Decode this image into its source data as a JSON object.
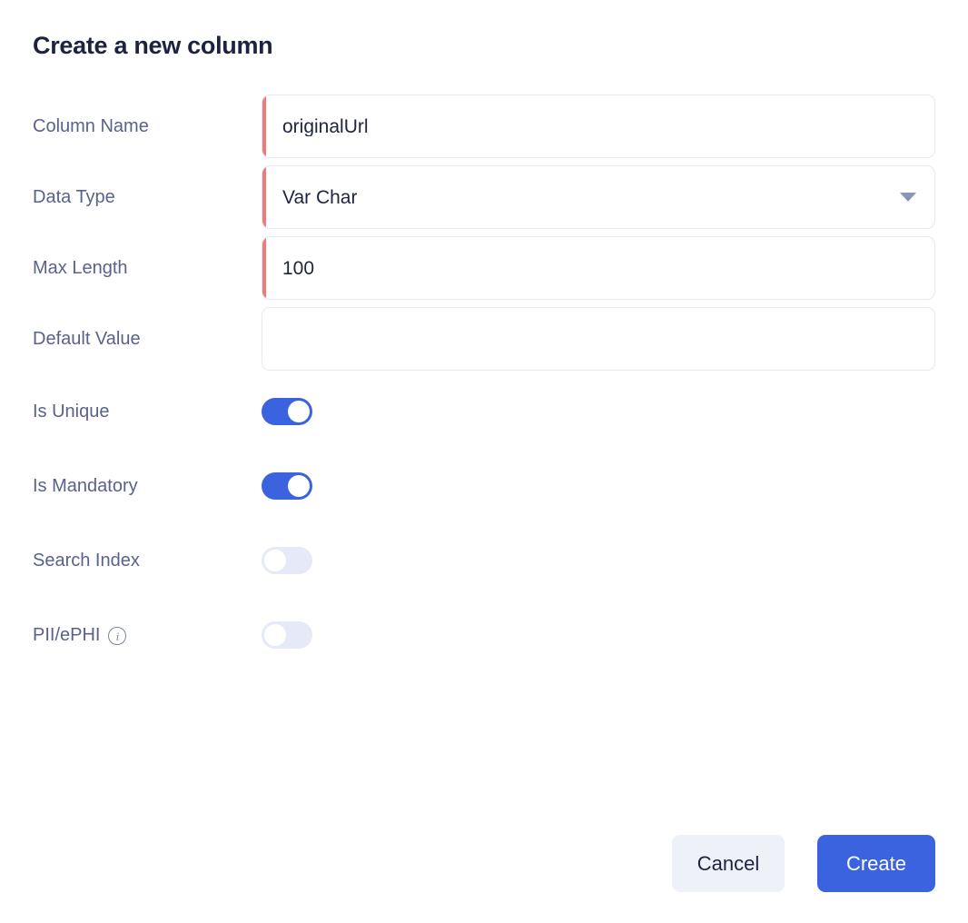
{
  "dialog": {
    "title": "Create a new column"
  },
  "fields": [
    {
      "label": "Column Name",
      "type": "text",
      "value": "originalUrl",
      "placeholder": "",
      "required": true
    },
    {
      "label": "Data Type",
      "type": "select",
      "value": "Var Char",
      "placeholder": "",
      "required": true,
      "caret_icon": "chevron-down-icon"
    },
    {
      "label": "Max Length",
      "type": "text",
      "value": "100",
      "placeholder": "",
      "required": true
    },
    {
      "label": "Default Value",
      "type": "text",
      "value": "",
      "placeholder": "",
      "required": false
    }
  ],
  "toggles": [
    {
      "label": "Is Unique",
      "state": "on",
      "has_info_icon": false
    },
    {
      "label": "Is Mandatory",
      "state": "on",
      "has_info_icon": false
    },
    {
      "label": "Search Index",
      "state": "off",
      "has_info_icon": false
    },
    {
      "label": "PII/ePHI",
      "state": "off",
      "has_info_icon": true,
      "info_icon": "info-icon",
      "info_glyph": "i"
    }
  ],
  "footer": {
    "cancel_label": "Cancel",
    "create_label": "Create"
  },
  "colors": {
    "accent_blue": "#3b63e0",
    "required_marker": "#ef7b77",
    "label_text": "#59628a",
    "title_text": "#1c2240",
    "input_border": "#e6e8f4",
    "toggle_off_track": "#e6eaf8",
    "cancel_bg": "#eff1f9"
  }
}
